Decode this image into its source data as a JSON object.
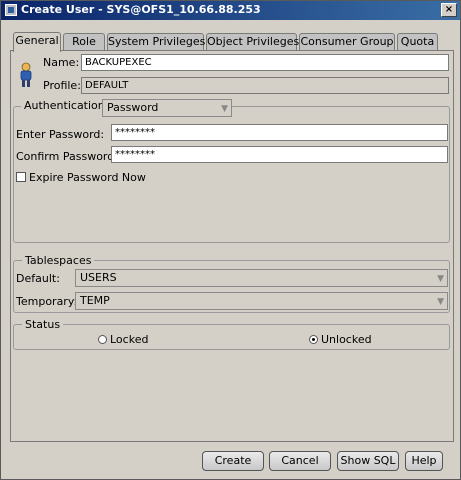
{
  "window": {
    "title": "Create User - SYS@OFS1_10.66.88.253",
    "close_glyph": "×"
  },
  "tabs": [
    {
      "label": "General",
      "active": true
    },
    {
      "label": "Role"
    },
    {
      "label": "System Privileges"
    },
    {
      "label": "Object Privileges"
    },
    {
      "label": "Consumer Group"
    },
    {
      "label": "Quota"
    }
  ],
  "general": {
    "user_icon": "user-icon",
    "name_label": "Name:",
    "name_value": "BACKUPEXEC",
    "profile_label": "Profile:",
    "profile_value": "DEFAULT"
  },
  "authentication": {
    "legend": "Authentication",
    "method": "Password",
    "enter_password_label": "Enter Password:",
    "enter_password_value": "********",
    "confirm_password_label": "Confirm Password:",
    "confirm_password_value": "********",
    "expire_label": "Expire Password Now",
    "expire_checked": false
  },
  "tablespaces": {
    "legend": "Tablespaces",
    "default_label": "Default:",
    "default_value": "USERS",
    "temporary_label": "Temporary:",
    "temporary_value": "TEMP"
  },
  "status": {
    "legend": "Status",
    "locked_label": "Locked",
    "unlocked_label": "Unlocked",
    "selected": "Unlocked"
  },
  "buttons": {
    "create": "Create",
    "cancel": "Cancel",
    "show_sql": "Show SQL",
    "help": "Help"
  },
  "colors": {
    "titlebar_start": "#0a246a",
    "titlebar_end": "#3a6ea5",
    "dialog_bg": "#d4d0c8"
  }
}
